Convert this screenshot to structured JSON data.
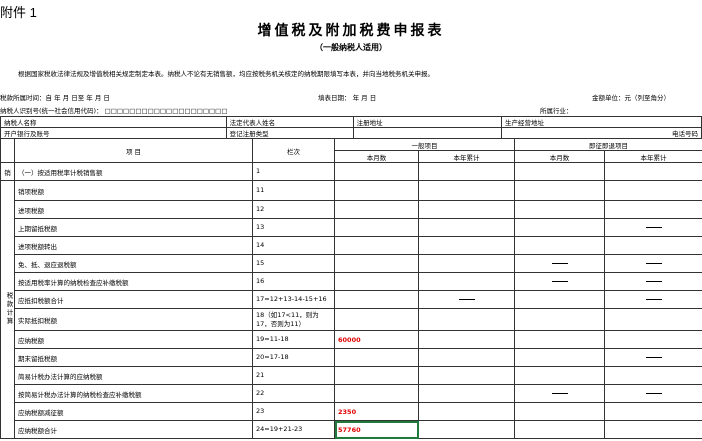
{
  "header": {
    "annex": "附件 1",
    "title": "增值税及附加税费申报表",
    "subtitle": "（一般纳税人适用）",
    "intro": "根据国家税收法律法规及增值税相关规定制定本表。纳税人不论有无销售额，均应按税务机关核定的纳税期限填写本表，并向当地税务机关申报。"
  },
  "meta": {
    "period_label": "税款所属时间：自   年   月   日至   年   月   日",
    "fill_date": "填表日期：  年  月  日",
    "unit": "金额单位：元（列至角分）",
    "taxpayer_id": "纳税人识别号(统一社会信用代码)：    □□□□□□□□□□□□□□□□□□□□",
    "industry": "所属行业："
  },
  "info_rows": [
    [
      "纳税人名称",
      "法定代表人姓名",
      "注册地址",
      "生产经营地址"
    ],
    [
      "开户银行及账号",
      "登记注册类型",
      "电话号码"
    ]
  ],
  "table": {
    "col_item": "项  目",
    "col_line": "栏次",
    "group_general": "一般项目",
    "group_refund": "即征即退项目",
    "col_month": "本月数",
    "col_year": "本年累计",
    "side_top": "销",
    "side_calc": "税款计算",
    "rows": [
      {
        "item": "（一）按适用税率计税销售额",
        "line": "1",
        "m": "",
        "y": "",
        "rm": "",
        "ry": ""
      },
      {
        "item": "销项税额",
        "line": "11",
        "m": "",
        "y": "",
        "rm": "",
        "ry": ""
      },
      {
        "item": "进项税额",
        "line": "12",
        "m": "",
        "y": "",
        "rm": "",
        "ry": ""
      },
      {
        "item": "上期留抵税额",
        "line": "13",
        "m": "",
        "y": "",
        "rm": "",
        "ry": "——"
      },
      {
        "item": "进项税额转出",
        "line": "14",
        "m": "",
        "y": "",
        "rm": "",
        "ry": ""
      },
      {
        "item": "免、抵、退应退税额",
        "line": "15",
        "m": "",
        "y": "",
        "rm": "——",
        "ry": "——"
      },
      {
        "item": "按适用税率计算的纳税检查应补缴税额",
        "line": "16",
        "m": "",
        "y": "",
        "rm": "——",
        "ry": "——"
      },
      {
        "item": "应抵扣税额合计",
        "line": "17=12+13-14-15+16",
        "m": "",
        "y": "——",
        "rm": "",
        "ry": "——"
      },
      {
        "item": "实际抵扣税额",
        "line": "18（如17<11，则为17，否则为11）",
        "m": "",
        "y": "",
        "rm": "",
        "ry": ""
      },
      {
        "item": "应纳税额",
        "line": "19=11-18",
        "m": "60000",
        "y": "",
        "rm": "",
        "ry": ""
      },
      {
        "item": "期末留抵税额",
        "line": "20=17-18",
        "m": "",
        "y": "",
        "rm": "",
        "ry": "——"
      },
      {
        "item": "简易计税办法计算的应纳税额",
        "line": "21",
        "m": "",
        "y": "",
        "rm": "",
        "ry": ""
      },
      {
        "item": "按简易计税办法计算的纳税检查应补缴税额",
        "line": "22",
        "m": "",
        "y": "",
        "rm": "——",
        "ry": "——"
      },
      {
        "item": "应纳税额减征额",
        "line": "23",
        "m": "2350",
        "y": "",
        "rm": "",
        "ry": ""
      },
      {
        "item": "应纳税额合计",
        "line": "24=19+21-23",
        "m": "57760",
        "y": "",
        "rm": "",
        "ry": ""
      }
    ]
  }
}
